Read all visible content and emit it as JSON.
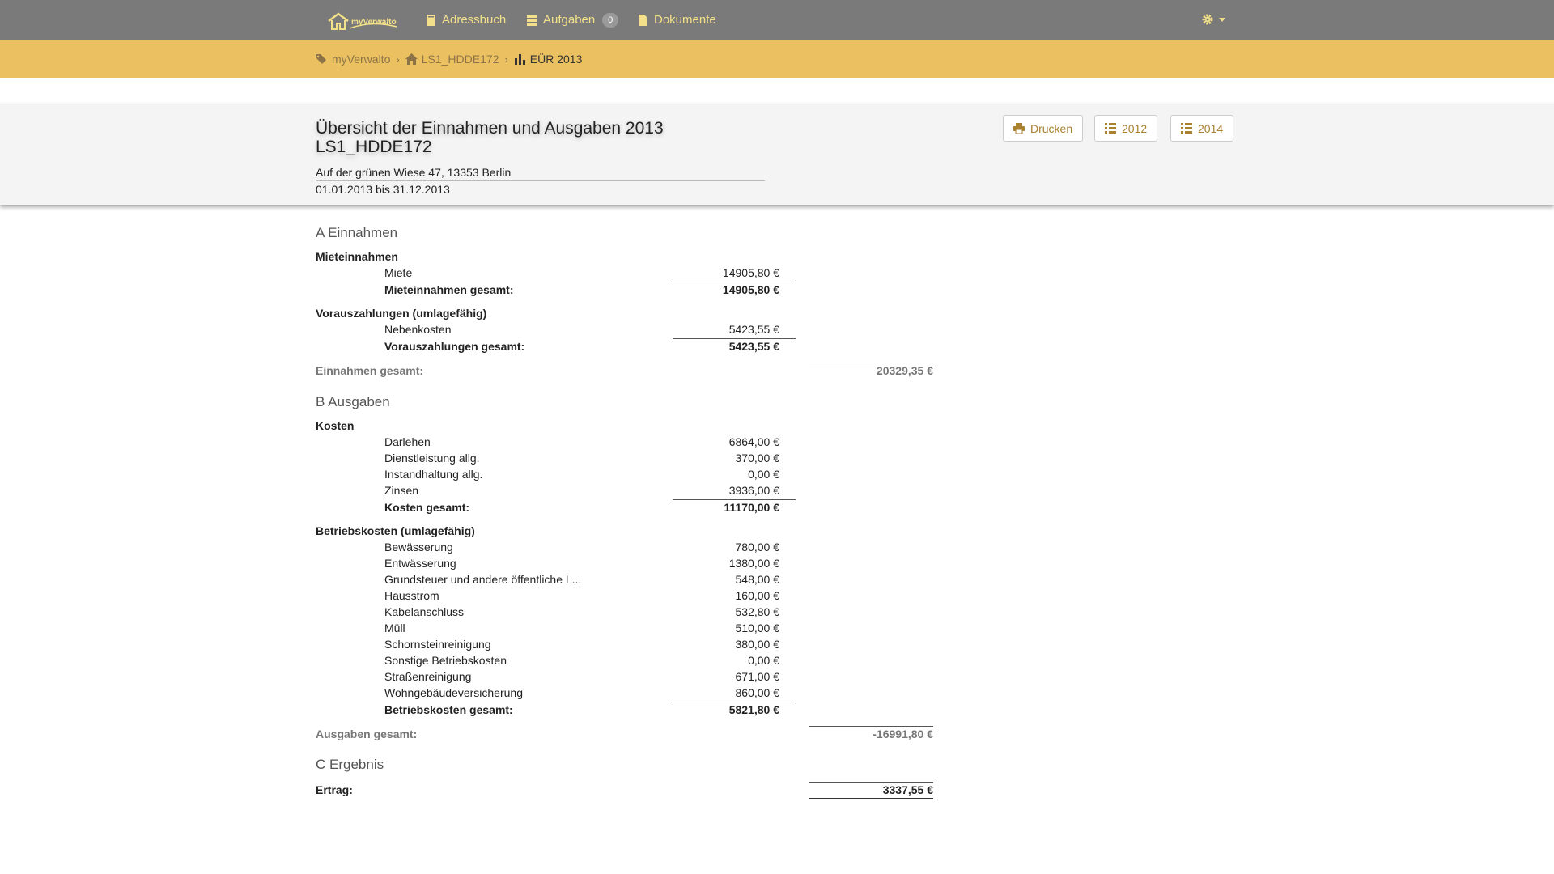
{
  "nav": {
    "brand": "myVerwalto",
    "address_book": "Adressbuch",
    "tasks": "Aufgaben",
    "tasks_count": "0",
    "documents": "Dokumente"
  },
  "breadcrumb": {
    "root": "myVerwalto",
    "property": "LS1_HDDE172",
    "current": "EÜR 2013"
  },
  "header": {
    "title_line1": "Übersicht der Einnahmen und Ausgaben 2013",
    "title_line2": "LS1_HDDE172",
    "address": "Auf der grünen Wiese 47, 13353 Berlin",
    "period": "01.01.2013 bis 31.12.2013",
    "print_label": "Drucken",
    "prev_year": "2012",
    "next_year": "2014"
  },
  "income": {
    "heading": "A Einnahmen",
    "rent_group": "Mieteinnahmen",
    "rent_items": [
      {
        "label": "Miete",
        "value": "14905,80 €"
      }
    ],
    "rent_total_label": "Mieteinnahmen gesamt:",
    "rent_total": "14905,80 €",
    "advance_group": "Vorauszahlungen (umlagefähig)",
    "advance_items": [
      {
        "label": "Nebenkosten",
        "value": "5423,55 €"
      }
    ],
    "advance_total_label": "Vorauszahlungen gesamt:",
    "advance_total": "5423,55 €",
    "total_label": "Einnahmen gesamt:",
    "total": "20329,35 €"
  },
  "expenses": {
    "heading": "B Ausgaben",
    "costs_group": "Kosten",
    "costs_items": [
      {
        "label": "Darlehen",
        "value": "6864,00 €"
      },
      {
        "label": "Dienstleistung allg.",
        "value": "370,00 €"
      },
      {
        "label": "Instandhaltung allg.",
        "value": "0,00 €"
      },
      {
        "label": "Zinsen",
        "value": "3936,00 €"
      }
    ],
    "costs_total_label": "Kosten gesamt:",
    "costs_total": "11170,00 €",
    "operating_group": "Betriebskosten (umlagefähig)",
    "operating_items": [
      {
        "label": "Bewässerung",
        "value": "780,00 €"
      },
      {
        "label": "Entwässerung",
        "value": "1380,00 €"
      },
      {
        "label": "Grundsteuer und andere öffentliche L...",
        "value": "548,00 €"
      },
      {
        "label": "Hausstrom",
        "value": "160,00 €"
      },
      {
        "label": "Kabelanschluss",
        "value": "532,80 €"
      },
      {
        "label": "Müll",
        "value": "510,00 €"
      },
      {
        "label": "Schornsteinreinigung",
        "value": "380,00 €"
      },
      {
        "label": "Sonstige Betriebskosten",
        "value": "0,00 €"
      },
      {
        "label": "Straßenreinigung",
        "value": "671,00 €"
      },
      {
        "label": "Wohngebäudeversicherung",
        "value": "860,00 €"
      }
    ],
    "operating_total_label": "Betriebskosten gesamt:",
    "operating_total": "5821,80 €",
    "total_label": "Ausgaben gesamt:",
    "total": "-16991,80 €"
  },
  "result": {
    "heading": "C Ergebnis",
    "label": "Ertrag:",
    "value": "3337,55 €"
  },
  "colors": {
    "navbar": "#7a7a7a",
    "nav_text": "#f3e08a",
    "breadcrumb_bar": "#ebc060",
    "button_text": "#a9812f"
  }
}
